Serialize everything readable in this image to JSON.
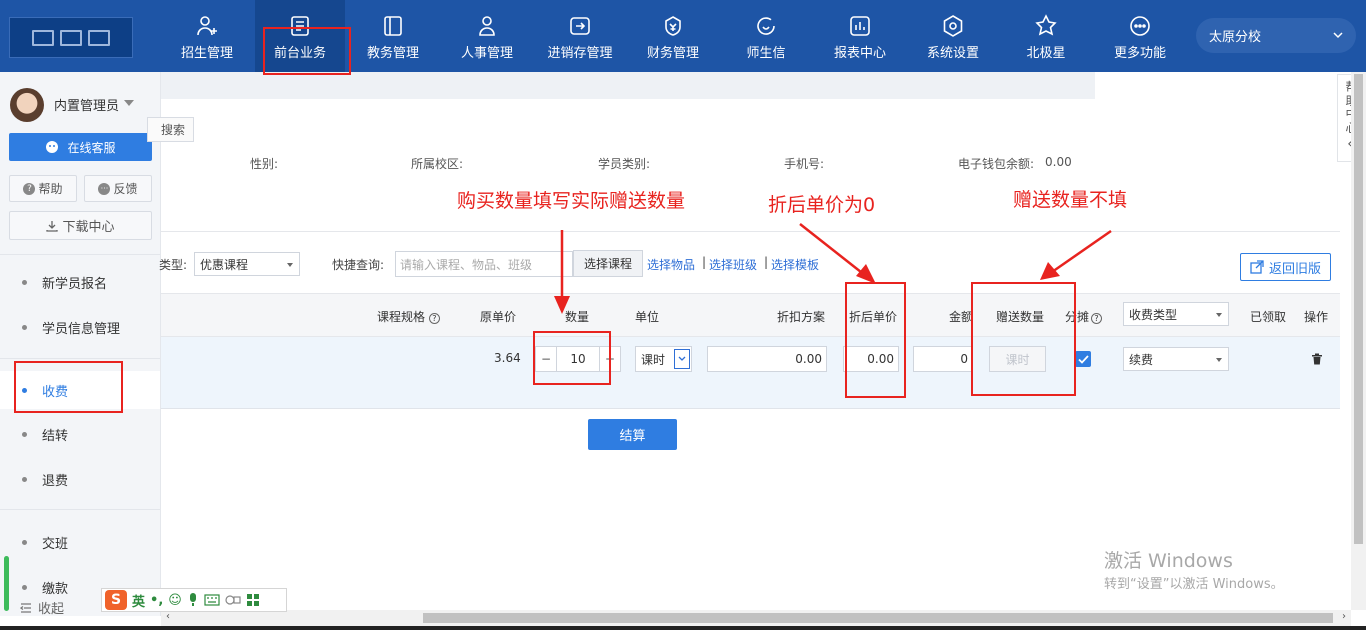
{
  "nav": {
    "items": [
      {
        "label": "招生管理",
        "icon": "user-add-icon"
      },
      {
        "label": "前台业务",
        "icon": "document-icon"
      },
      {
        "label": "教务管理",
        "icon": "book-icon"
      },
      {
        "label": "人事管理",
        "icon": "person-icon"
      },
      {
        "label": "进销存管理",
        "icon": "inventory-icon"
      },
      {
        "label": "财务管理",
        "icon": "money-bag-icon"
      },
      {
        "label": "师生信",
        "icon": "chat-icon"
      },
      {
        "label": "报表中心",
        "icon": "report-icon"
      },
      {
        "label": "系统设置",
        "icon": "gear-icon"
      },
      {
        "label": "北极星",
        "icon": "star-icon"
      },
      {
        "label": "更多功能",
        "icon": "more-icon"
      }
    ],
    "branch": "太原分校"
  },
  "annotations": {
    "qty_note": "购买数量填写实际赠送数量",
    "price_note": "折后单价为0",
    "gift_note": "赠送数量不填"
  },
  "sidebar": {
    "username": "内置管理员",
    "online_service": "在线客服",
    "help": "帮助",
    "feedback": "反馈",
    "download_center": "下载中心",
    "items": [
      "新学员报名",
      "学员信息管理",
      "收费",
      "结转",
      "退费",
      "交班",
      "缴款"
    ],
    "collapse": "收起"
  },
  "ime": {
    "lang": "英"
  },
  "student_info": {
    "search_label": "搜索",
    "gender_label": "性别:",
    "campus_label": "所属校区:",
    "category_label": "学员类别:",
    "phone_label": "手机号:",
    "wallet_label": "电子钱包余额:",
    "wallet_value": "0.00"
  },
  "filter": {
    "type_label": "类型:",
    "type_value": "优惠课程",
    "quick_label": "快捷查询:",
    "quick_placeholder": "请输入课程、物品、班级",
    "pick_course": "选择课程",
    "pick_item": "选择物品",
    "pick_class": "选择班级",
    "pick_template": "选择模板",
    "separator": "|",
    "return_old": "返回旧版"
  },
  "table": {
    "headers": {
      "spec": "课程规格",
      "orig_price": "原单价",
      "quantity": "数量",
      "unit": "单位",
      "discount_plan": "折扣方案",
      "discounted_price": "折后单价",
      "amount": "金额",
      "gift_qty": "赠送数量",
      "split": "分摊",
      "fee_type": "收费类型",
      "received": "已领取",
      "action": "操作"
    },
    "row": {
      "orig_price": "3.64",
      "minus": "−",
      "quantity": "10",
      "plus": "+",
      "unit": "课时",
      "discount": "0.00",
      "discounted_price": "0.00",
      "amount": "0",
      "gift_placeholder": "课时",
      "fee_type": "续费"
    }
  },
  "settle_label": "结算",
  "help_center": [
    "帮",
    "助",
    "中",
    "心"
  ],
  "watermark": {
    "line1": "激活 Windows",
    "line2": "转到“设置”以激活 Windows。"
  },
  "colors": {
    "nav_bg": "#1e55a6",
    "accent": "#2f7de1",
    "annotation": "#e8231f"
  }
}
